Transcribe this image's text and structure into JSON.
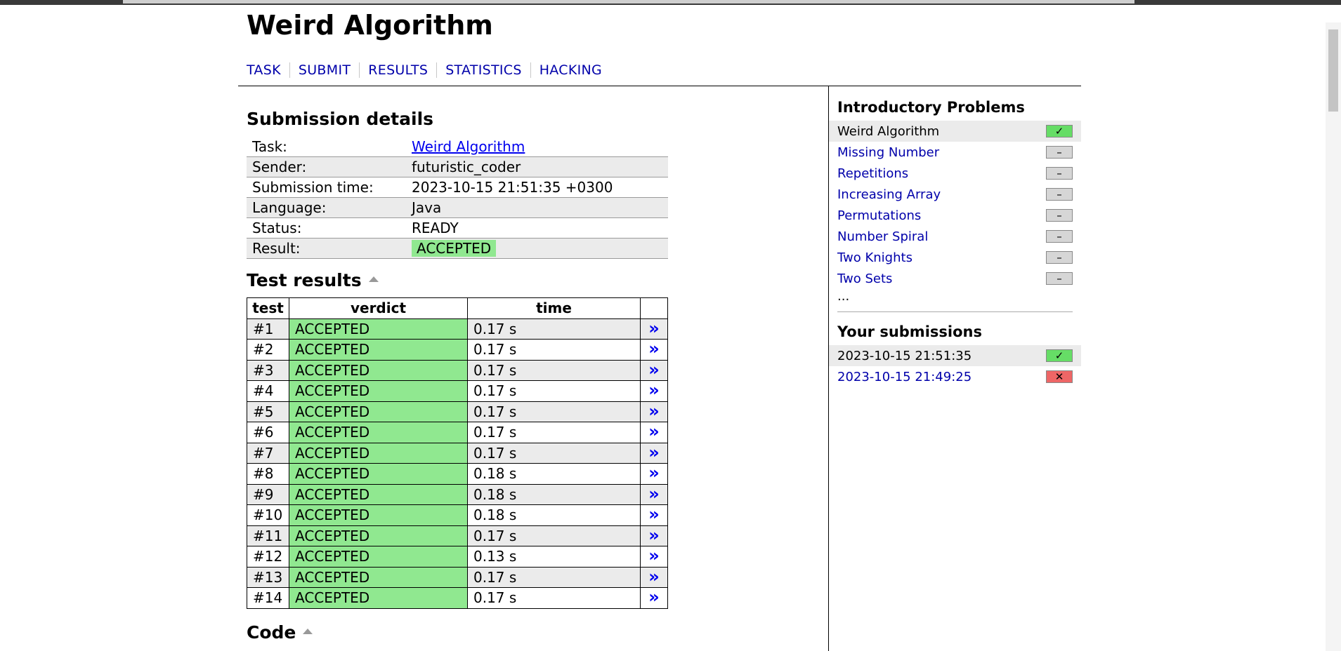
{
  "page": {
    "title": "Weird Algorithm"
  },
  "nav": [
    {
      "label": "TASK"
    },
    {
      "label": "SUBMIT"
    },
    {
      "label": "RESULTS"
    },
    {
      "label": "STATISTICS"
    },
    {
      "label": "HACKING"
    }
  ],
  "submission": {
    "heading": "Submission details",
    "rows": [
      {
        "label": "Task:",
        "value": "Weird Algorithm"
      },
      {
        "label": "Sender:",
        "value": "futuristic_coder"
      },
      {
        "label": "Submission time:",
        "value": "2023-10-15 21:51:35 +0300"
      },
      {
        "label": "Language:",
        "value": "Java"
      },
      {
        "label": "Status:",
        "value": "READY"
      },
      {
        "label": "Result:",
        "value": "ACCEPTED"
      }
    ]
  },
  "tests": {
    "heading": "Test results",
    "columns": [
      "test",
      "verdict",
      "time",
      ""
    ],
    "rows": [
      {
        "test": "#1",
        "verdict": "ACCEPTED",
        "time": "0.17 s"
      },
      {
        "test": "#2",
        "verdict": "ACCEPTED",
        "time": "0.17 s"
      },
      {
        "test": "#3",
        "verdict": "ACCEPTED",
        "time": "0.17 s"
      },
      {
        "test": "#4",
        "verdict": "ACCEPTED",
        "time": "0.17 s"
      },
      {
        "test": "#5",
        "verdict": "ACCEPTED",
        "time": "0.17 s"
      },
      {
        "test": "#6",
        "verdict": "ACCEPTED",
        "time": "0.17 s"
      },
      {
        "test": "#7",
        "verdict": "ACCEPTED",
        "time": "0.17 s"
      },
      {
        "test": "#8",
        "verdict": "ACCEPTED",
        "time": "0.18 s"
      },
      {
        "test": "#9",
        "verdict": "ACCEPTED",
        "time": "0.18 s"
      },
      {
        "test": "#10",
        "verdict": "ACCEPTED",
        "time": "0.18 s"
      },
      {
        "test": "#11",
        "verdict": "ACCEPTED",
        "time": "0.17 s"
      },
      {
        "test": "#12",
        "verdict": "ACCEPTED",
        "time": "0.13 s"
      },
      {
        "test": "#13",
        "verdict": "ACCEPTED",
        "time": "0.17 s"
      },
      {
        "test": "#14",
        "verdict": "ACCEPTED",
        "time": "0.17 s"
      }
    ],
    "link_glyph": "»"
  },
  "code": {
    "heading": "Code"
  },
  "sidebar": {
    "problems_heading": "Introductory Problems",
    "problems": [
      {
        "name": "Weird Algorithm",
        "status": "solved",
        "current": true
      },
      {
        "name": "Missing Number",
        "status": "none"
      },
      {
        "name": "Repetitions",
        "status": "none"
      },
      {
        "name": "Increasing Array",
        "status": "none"
      },
      {
        "name": "Permutations",
        "status": "none"
      },
      {
        "name": "Number Spiral",
        "status": "none"
      },
      {
        "name": "Two Knights",
        "status": "none"
      },
      {
        "name": "Two Sets",
        "status": "none"
      }
    ],
    "more": "...",
    "submissions_heading": "Your submissions",
    "submissions": [
      {
        "time": "2023-10-15 21:51:35",
        "result": "accepted",
        "current": true
      },
      {
        "time": "2023-10-15 21:49:25",
        "result": "rejected"
      }
    ],
    "status_glyphs": {
      "none": "–",
      "solved": "✓",
      "accepted": "✓",
      "rejected": "✕"
    }
  },
  "colors": {
    "accepted_bg": "#90e890",
    "solved_box": "#66dd66",
    "rejected_box": "#ee6666",
    "link": "#0000aa"
  }
}
